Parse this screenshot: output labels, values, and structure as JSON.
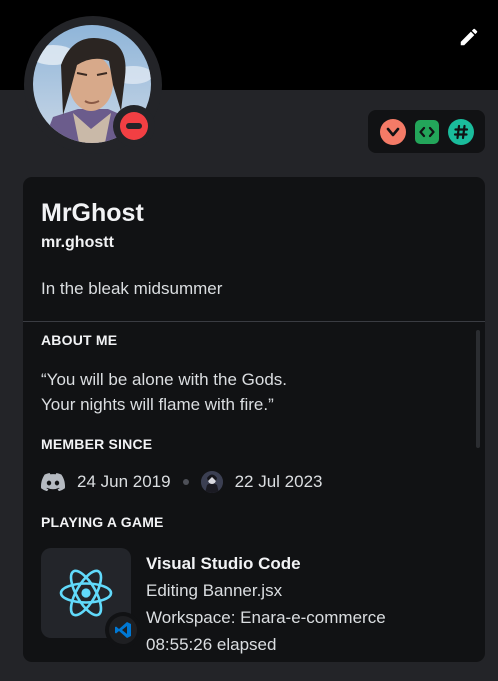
{
  "banner": {
    "edit_icon": "pencil-icon"
  },
  "profile": {
    "status": "do-not-disturb",
    "display_name": "MrGhost",
    "username": "mr.ghostt",
    "custom_status": "In the bleak midsummer"
  },
  "badges": [
    {
      "icon": "hypesquad-bravery-icon",
      "color": "#f47b67"
    },
    {
      "icon": "active-developer-icon",
      "color": "#23a55a"
    },
    {
      "icon": "hashtag-icon",
      "color": "#1abc9c"
    }
  ],
  "about": {
    "title": "ABOUT ME",
    "line1": "“You will be alone with the Gods.",
    "line2": "Your nights will flame with fire.”"
  },
  "member_since": {
    "title": "MEMBER SINCE",
    "discord_date": "24 Jun 2019",
    "server_date": "22 Jul 2023"
  },
  "activity": {
    "title": "PLAYING A GAME",
    "name": "Visual Studio Code",
    "details": "Editing Banner.jsx",
    "state": "Workspace: Enara-e-commerce",
    "elapsed": "08:55:26 elapsed"
  },
  "colors": {
    "banner": "#000000",
    "card": "#111214",
    "dnd": "#f23f43",
    "react": "#61dafb",
    "vscode": "#0078d4"
  }
}
